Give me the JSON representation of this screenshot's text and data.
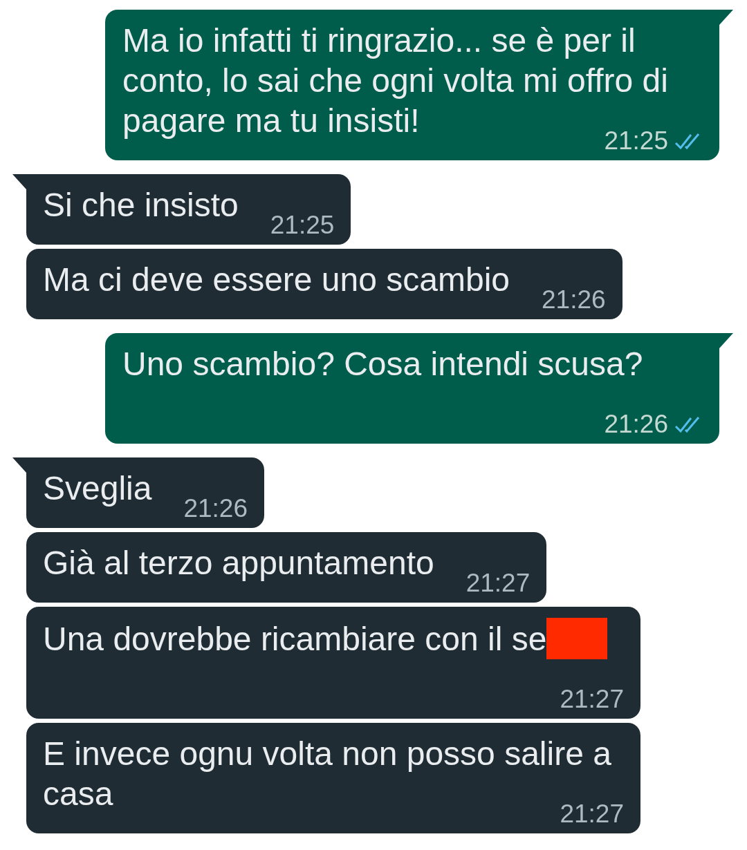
{
  "messages": [
    {
      "kind": "out",
      "tail": true,
      "text": "Ma io infatti ti ringrazio... se è per il conto, lo sai che ogni volta mi offro di pagare ma tu insisti!",
      "time": "21:25",
      "read": true
    },
    {
      "kind": "in",
      "tail": true,
      "text": "Si che insisto",
      "time": "21:25"
    },
    {
      "kind": "in",
      "tail": false,
      "text": "Ma ci deve essere uno scambio",
      "time": "21:26"
    },
    {
      "kind": "out",
      "tail": true,
      "text": "Uno scambio? Cosa intendi scusa?",
      "time": "21:26",
      "read": true
    },
    {
      "kind": "in",
      "tail": true,
      "text": "Sveglia",
      "time": "21:26"
    },
    {
      "kind": "in",
      "tail": false,
      "text": "Già al terzo appuntamento",
      "time": "21:27"
    },
    {
      "kind": "in",
      "tail": false,
      "text": "Una dovrebbe ricambiare con il se",
      "time": "21:27",
      "redacted": true
    },
    {
      "kind": "in",
      "tail": false,
      "text": "E invece ognu volta non posso salire a casa",
      "time": "21:27"
    }
  ]
}
